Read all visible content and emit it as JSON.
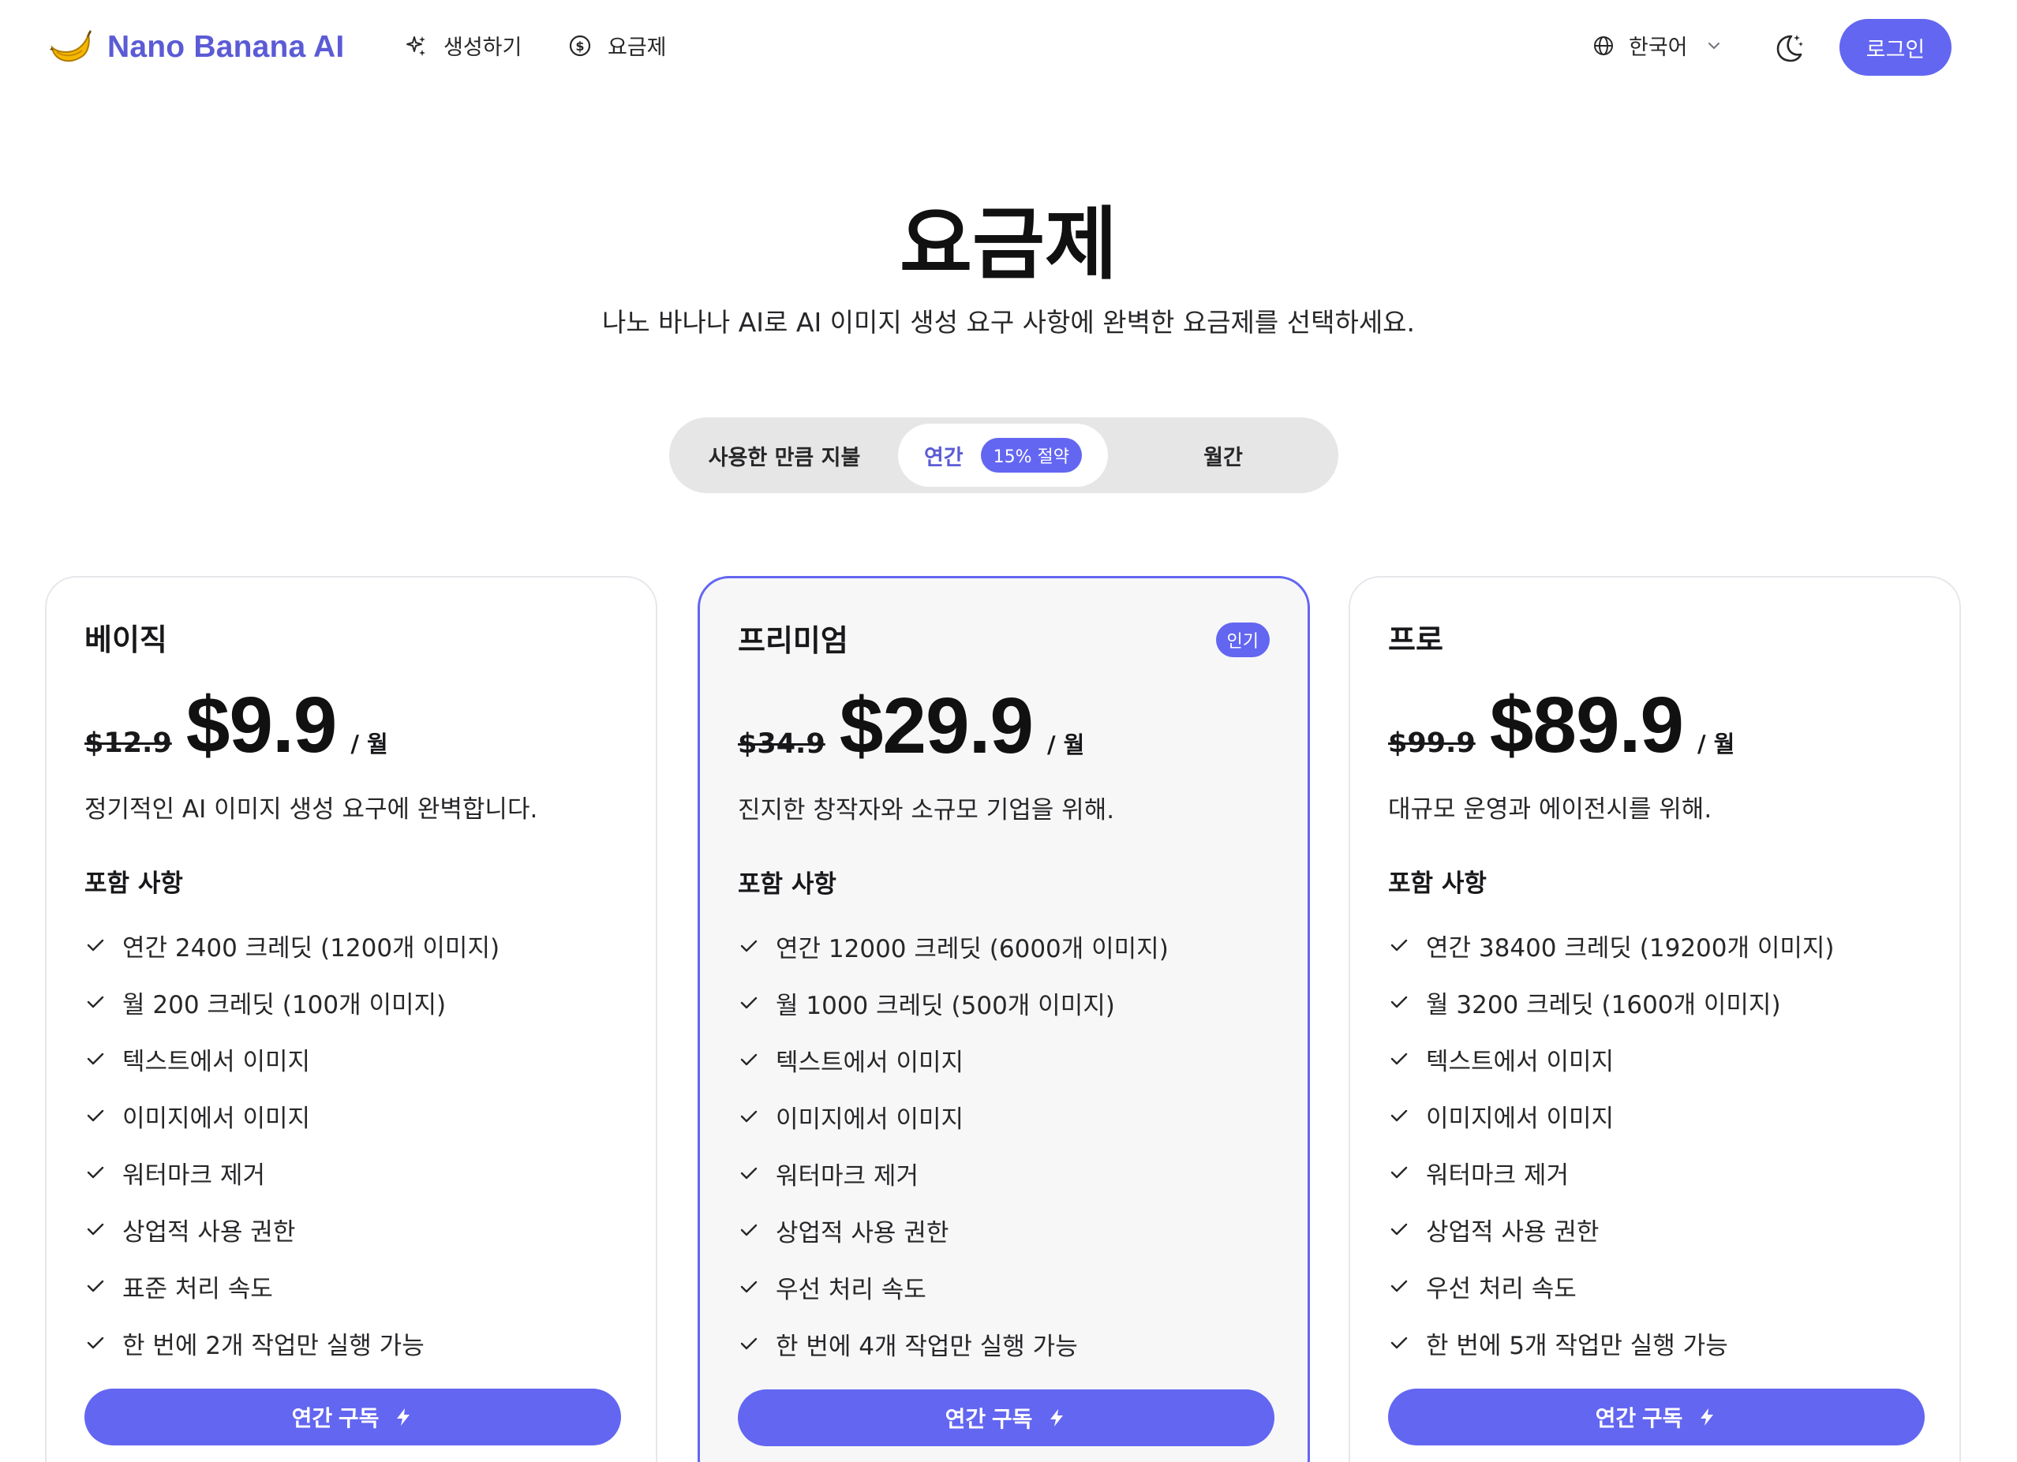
{
  "header": {
    "brand": "Nano Banana AI",
    "brand_color": "#5b5bd6",
    "nav": [
      {
        "label": "생성하기",
        "icon": "sparkles-icon"
      },
      {
        "label": "요금제",
        "icon": "dollar-circle-icon"
      }
    ],
    "language": "한국어",
    "login_label": "로그인",
    "accent_color": "#6366f1"
  },
  "hero": {
    "title": "요금제",
    "subtitle": "나노 바나나 AI로 AI 이미지 생성 요구 사항에 완벽한 요금제를 선택하세요."
  },
  "billing_toggle": {
    "options": [
      "사용한 만큼 지불",
      "연간",
      "월간"
    ],
    "selected": "연간",
    "save_badge": "15% 절약"
  },
  "plans": [
    {
      "name": "베이직",
      "old_price": "$12.9",
      "price": "$9.9",
      "per": "/ 월",
      "description": "정기적인 AI 이미지 생성 요구에 완벽합니다.",
      "includes_title": "포함 사항",
      "features": [
        "연간 2400 크레딧 (1200개 이미지)",
        "월 200 크레딧 (100개 이미지)",
        "텍스트에서 이미지",
        "이미지에서 이미지",
        "워터마크 제거",
        "상업적 사용 권한",
        "표준 처리 속도",
        "한 번에 2개 작업만 실행 가능"
      ],
      "button": "연간 구독"
    },
    {
      "name": "프리미엄",
      "badge": "인기",
      "old_price": "$34.9",
      "price": "$29.9",
      "per": "/ 월",
      "description": "진지한 창작자와 소규모 기업을 위해.",
      "includes_title": "포함 사항",
      "features": [
        "연간 12000 크레딧 (6000개 이미지)",
        "월 1000 크레딧 (500개 이미지)",
        "텍스트에서 이미지",
        "이미지에서 이미지",
        "워터마크 제거",
        "상업적 사용 권한",
        "우선 처리 속도",
        "한 번에 4개 작업만 실행 가능"
      ],
      "button": "연간 구독"
    },
    {
      "name": "프로",
      "old_price": "$99.9",
      "price": "$89.9",
      "per": "/ 월",
      "description": "대규모 운영과 에이전시를 위해.",
      "includes_title": "포함 사항",
      "features": [
        "연간 38400 크레딧 (19200개 이미지)",
        "월 3200 크레딧 (1600개 이미지)",
        "텍스트에서 이미지",
        "이미지에서 이미지",
        "워터마크 제거",
        "상업적 사용 권한",
        "우선 처리 속도",
        "한 번에 5개 작업만 실행 가능"
      ],
      "button": "연간 구독"
    }
  ]
}
